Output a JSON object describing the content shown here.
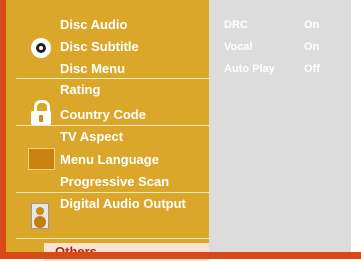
{
  "menu": {
    "items": [
      {
        "label": "Disc Audio"
      },
      {
        "label": "Disc Subtitle"
      },
      {
        "label": "Disc Menu"
      },
      {
        "label": "Rating"
      },
      {
        "label": "Country Code"
      },
      {
        "label": "TV Aspect"
      },
      {
        "label": "Menu Language"
      },
      {
        "label": "Progressive Scan"
      },
      {
        "label": "Digital Audio Output"
      }
    ],
    "selected": {
      "label": "Others"
    }
  },
  "icons": {
    "disc": "disc-icon",
    "lock": "lock-icon",
    "tv": "tv-icon",
    "speaker": "speaker-icon"
  },
  "settings": [
    {
      "label": "DRC",
      "value": "On"
    },
    {
      "label": "Vocal",
      "value": "On"
    },
    {
      "label": "Auto Play",
      "value": "Off"
    }
  ],
  "colors": {
    "sidebar": "#dba72a",
    "accent_red": "#d84a18",
    "panel": "#dcdcdc",
    "selected_bg": "#fbe3d2",
    "selected_text": "#b02810"
  }
}
